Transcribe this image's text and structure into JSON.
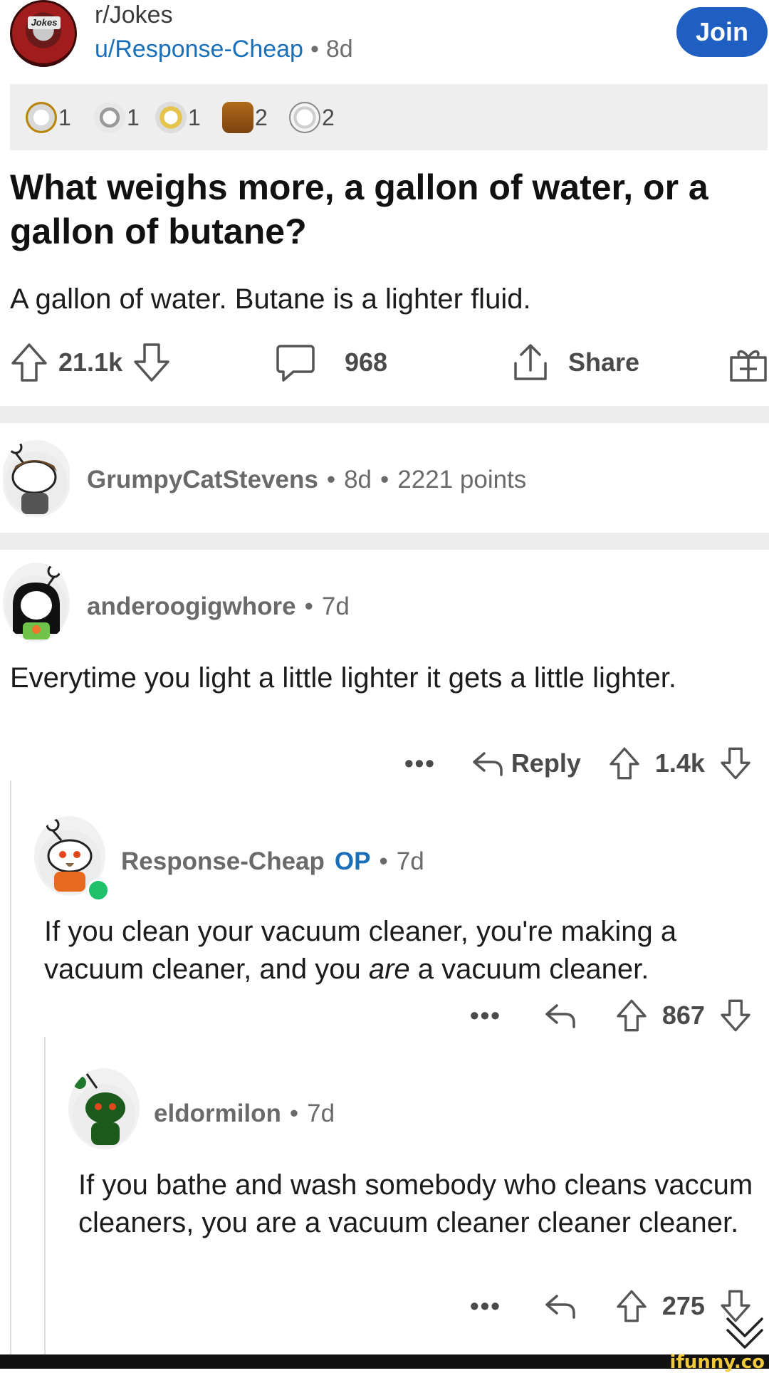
{
  "header": {
    "subreddit": "r/Jokes",
    "sub_badge": "Jokes",
    "username": "u/Response-Cheap",
    "age": "8d",
    "join_label": "Join"
  },
  "awards": [
    {
      "icon": "award-face-icon",
      "count": "1"
    },
    {
      "icon": "skull-award-icon",
      "count": "1"
    },
    {
      "icon": "party-award-icon",
      "count": "1"
    },
    {
      "icon": "chest-award-icon",
      "count": "2"
    },
    {
      "icon": "bowing-award-icon",
      "count": "2"
    }
  ],
  "post": {
    "title": "What weighs more, a gallon of water, or a gallon of butane?",
    "body": "A gallon of water. Butane is a lighter fluid.",
    "score": "21.1k",
    "comments": "968",
    "share_label": "Share"
  },
  "comments": [
    {
      "user": "GrumpyCatStevens",
      "age": "8d",
      "points": "2221 points"
    },
    {
      "user": "anderoogigwhore",
      "age": "7d",
      "text": "Everytime you light a little lighter it gets a little lighter.",
      "reply_label": "Reply",
      "score": "1.4k"
    },
    {
      "user": "Response-Cheap",
      "op_label": "OP",
      "age": "7d",
      "text_before": "If you clean your vacuum cleaner, you're making a vacuum cleaner, and you ",
      "text_em": "are",
      "text_after": " a vacuum cleaner.",
      "score": "867"
    },
    {
      "user": "eldormilon",
      "age": "7d",
      "text": "If you bathe and wash somebody who cleans vaccum cleaners, you are a vacuum cleaner cleaner cleaner.",
      "score": "275"
    }
  ],
  "colors": {
    "accent": "#1f5fc2",
    "op": "#1a6fb8",
    "online": "#1fc16b"
  },
  "watermark": "ifunny.co"
}
